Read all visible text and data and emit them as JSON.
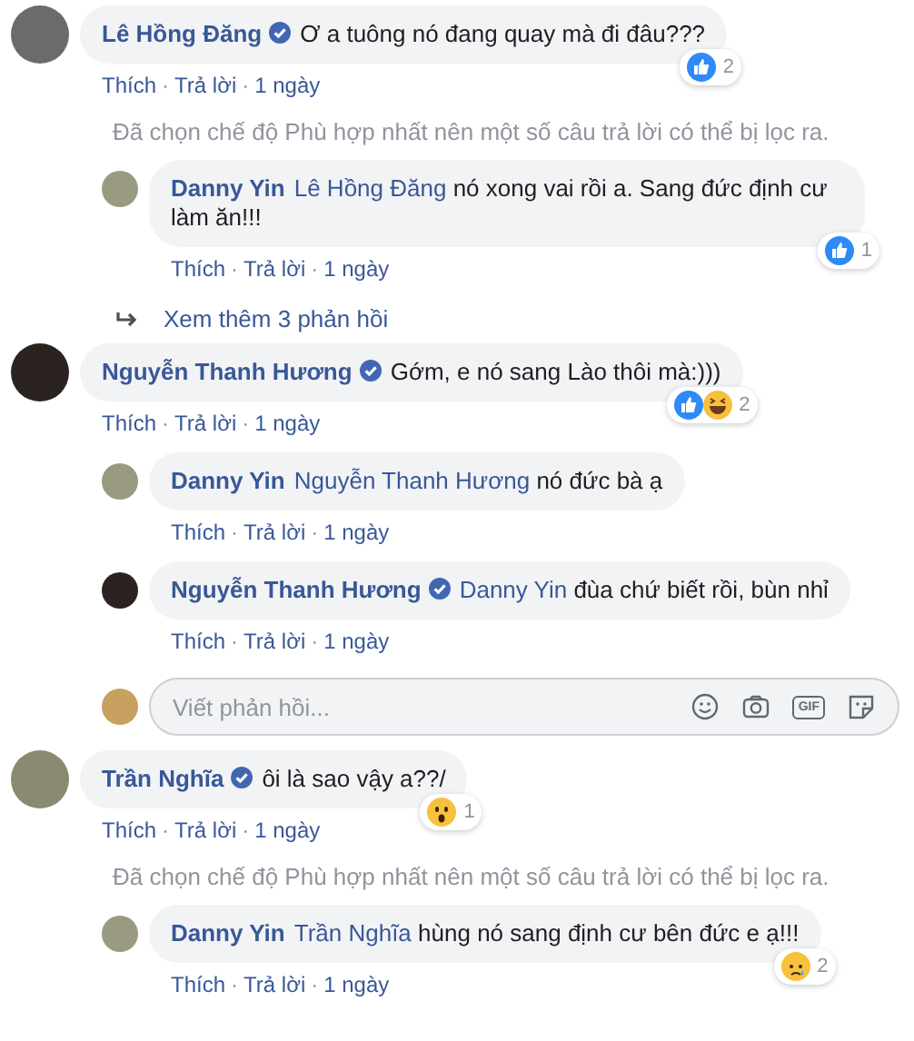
{
  "separator": "·",
  "threads": [
    {
      "author": "Lê Hồng Đăng",
      "verified": true,
      "text": "Ơ a tuông nó đang quay mà đi đâu???",
      "reactions": {
        "icons": [
          {
            "kind": "like"
          }
        ],
        "count": "2"
      },
      "actions": [
        "Thích",
        "Trả lời"
      ],
      "time": "1 ngày",
      "filter_note": "Đã chọn chế độ Phù hợp nhất nên một số câu trả lời có thể bị lọc ra.",
      "replies": [
        {
          "author": "Danny Yin",
          "verified": false,
          "mention": "Lê Hồng Đăng",
          "text": "nó xong vai rồi a. Sang đức định cư làm ăn!!!",
          "reactions": {
            "icons": [
              {
                "kind": "like"
              }
            ],
            "count": "1"
          },
          "actions": [
            "Thích",
            "Trả lời"
          ],
          "time": "1 ngày"
        }
      ],
      "more_replies": "Xem thêm 3 phản hồi"
    },
    {
      "author": "Nguyễn Thanh Hương",
      "verified": true,
      "text": "Gớm, e nó sang Lào thôi mà:)))",
      "reactions": {
        "icons": [
          {
            "kind": "like"
          },
          {
            "kind": "haha"
          }
        ],
        "count": "2"
      },
      "actions": [
        "Thích",
        "Trả lời"
      ],
      "time": "1 ngày",
      "replies": [
        {
          "author": "Danny Yin",
          "verified": false,
          "mention": "Nguyễn Thanh Hương",
          "text": "nó đức bà ạ",
          "actions": [
            "Thích",
            "Trả lời"
          ],
          "time": "1 ngày"
        },
        {
          "author": "Nguyễn Thanh Hương",
          "verified": true,
          "mention": "Danny Yin",
          "text": "đùa chứ biết rồi, bùn nhỉ",
          "actions": [
            "Thích",
            "Trả lời"
          ],
          "time": "1 ngày"
        }
      ],
      "reply_box": {
        "placeholder": "Viết phản hồi...",
        "gif_label": "GIF"
      }
    },
    {
      "author": "Trần Nghĩa",
      "verified": true,
      "text": "ôi là sao vậy a??/",
      "reactions": {
        "icons": [
          {
            "kind": "wow"
          }
        ],
        "count": "1"
      },
      "actions": [
        "Thích",
        "Trả lời"
      ],
      "time": "1 ngày",
      "filter_note": "Đã chọn chế độ Phù hợp nhất nên một số câu trả lời có thể bị lọc ra.",
      "replies": [
        {
          "author": "Danny Yin",
          "verified": false,
          "mention": "Trần Nghĩa",
          "text": "hùng nó sang định cư bên đức e ạ!!!",
          "reactions": {
            "icons": [
              {
                "kind": "sad"
              }
            ],
            "count": "2"
          },
          "actions": [
            "Thích",
            "Trả lời"
          ],
          "time": "1 ngày"
        }
      ]
    }
  ]
}
